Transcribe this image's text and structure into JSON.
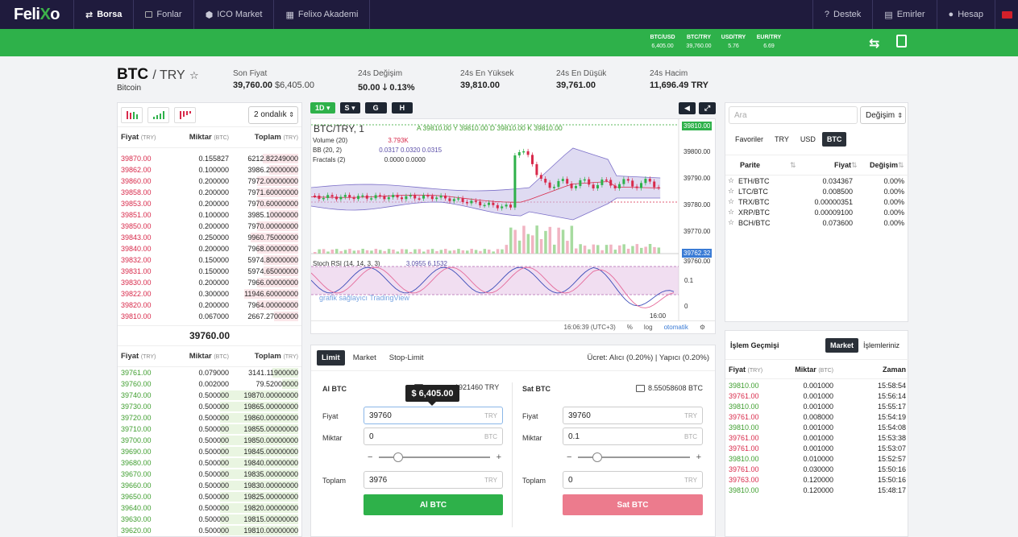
{
  "nav": {
    "logo_a": "Feli",
    "logo_x": "X",
    "logo_b": "o",
    "items": [
      {
        "label": "Borsa",
        "active": true
      },
      {
        "label": "Fonlar"
      },
      {
        "label": "ICO Market"
      },
      {
        "label": "Felixo Akademi"
      }
    ],
    "right": [
      {
        "label": "Destek"
      },
      {
        "label": "Emirler"
      },
      {
        "label": "Hesap"
      }
    ]
  },
  "tickers": [
    {
      "pair": "BTC/USD",
      "value": "6,405.00"
    },
    {
      "pair": "BTC/TRY",
      "value": "39,760.00"
    },
    {
      "pair": "USD/TRY",
      "value": "5.76"
    },
    {
      "pair": "EUR/TRY",
      "value": "6.69"
    }
  ],
  "header": {
    "symbol": "BTC",
    "quote": "/ TRY",
    "star": "☆",
    "name": "Bitcoin",
    "last": {
      "label": "Son Fiyat",
      "value": "39,760.00",
      "usd": "$6,405.00"
    },
    "change": {
      "label": "24s Değişim",
      "value": "50.00",
      "pct": "0.13%",
      "arrow": "🡓"
    },
    "high": {
      "label": "24s En Yüksek",
      "value": "39,810.00"
    },
    "low": {
      "label": "24s En Düşük",
      "value": "39,761.00"
    },
    "volume": {
      "label": "24s Hacim",
      "value": "11,696.49 TRY"
    }
  },
  "orderbook": {
    "decimals": "2 ondalık",
    "headers": {
      "price": "Fiyat",
      "price_unit": "(TRY)",
      "amount": "Miktar",
      "amount_unit": "(BTC)",
      "total": "Toplam",
      "total_unit": "(TRY)"
    },
    "asks": [
      [
        "39870.00",
        "0.155827",
        "6212.82249000"
      ],
      [
        "39862.00",
        "0.100000",
        "3986.20000000"
      ],
      [
        "39860.00",
        "0.200000",
        "7972.00000000"
      ],
      [
        "39858.00",
        "0.200000",
        "7971.60000000"
      ],
      [
        "39853.00",
        "0.200000",
        "7970.60000000"
      ],
      [
        "39851.00",
        "0.100000",
        "3985.10000000"
      ],
      [
        "39850.00",
        "0.200000",
        "7970.00000000"
      ],
      [
        "39843.00",
        "0.250000",
        "9960.75000000"
      ],
      [
        "39840.00",
        "0.200000",
        "7968.00000000"
      ],
      [
        "39832.00",
        "0.150000",
        "5974.80000000"
      ],
      [
        "39831.00",
        "0.150000",
        "5974.65000000"
      ],
      [
        "39830.00",
        "0.200000",
        "7966.00000000"
      ],
      [
        "39822.00",
        "0.300000",
        "11946.60000000"
      ],
      [
        "39820.00",
        "0.200000",
        "7964.00000000"
      ],
      [
        "39810.00",
        "0.067000",
        "2667.27000000"
      ]
    ],
    "mid": "39760.00",
    "bids": [
      [
        "39761.00",
        "0.079000",
        "3141.11900000"
      ],
      [
        "39760.00",
        "0.002000",
        "79.52000000"
      ],
      [
        "39740.00",
        "0.500000",
        "19870.00000000"
      ],
      [
        "39730.00",
        "0.500000",
        "19865.00000000"
      ],
      [
        "39720.00",
        "0.500000",
        "19860.00000000"
      ],
      [
        "39710.00",
        "0.500000",
        "19855.00000000"
      ],
      [
        "39700.00",
        "0.500000",
        "19850.00000000"
      ],
      [
        "39690.00",
        "0.500000",
        "19845.00000000"
      ],
      [
        "39680.00",
        "0.500000",
        "19840.00000000"
      ],
      [
        "39670.00",
        "0.500000",
        "19835.00000000"
      ],
      [
        "39660.00",
        "0.500000",
        "19830.00000000"
      ],
      [
        "39650.00",
        "0.500000",
        "19825.00000000"
      ],
      [
        "39640.00",
        "0.500000",
        "19820.00000000"
      ],
      [
        "39630.00",
        "0.500000",
        "19815.00000000"
      ],
      [
        "39620.00",
        "0.500000",
        "19810.00000000"
      ]
    ]
  },
  "chart": {
    "intervals": [
      "1D",
      "S",
      "G",
      "H"
    ],
    "title": "BTC/TRY, 1",
    "ohlc": "A 39810.00  Y 39810.00  D 39810.00  K 39810.00",
    "vol_label": "Volume (20)",
    "vol_val": "3.793K",
    "bb_label": "BB (20, 2)",
    "bb_vals": "0.0317  0.0320  0.0315",
    "fr_label": "Fractals (2)",
    "fr_vals": "0.0000  0.0000",
    "stoch_label": "Stoch RSI (14, 14, 3, 3)",
    "stoch_vals": "3.0955  6.1532",
    "watermark": "grafik sağlayıcı TradingView",
    "yticks": [
      "39810.00",
      "39800.00",
      "39790.00",
      "39780.00",
      "39770.00",
      "39762.32",
      "39760.00"
    ],
    "stoch_ticks": [
      "0.1",
      "0",
      "0.1"
    ],
    "time_tick": "16:00",
    "footer_time": "16:06:39 (UTC+3)",
    "footer_pct": "%",
    "footer_log": "log",
    "footer_auto": "otomatik"
  },
  "form": {
    "tabs": [
      "Limit",
      "Market",
      "Stop-Limit"
    ],
    "fee": "Ücret: Alıcı (0.20%) | Yapıcı (0.20%)",
    "buy": {
      "title": "Al BTC",
      "balance": "1921460 TRY",
      "price_label": "Fiyat",
      "price": "39760",
      "amount_label": "Miktar",
      "amount": "0",
      "total_label": "Toplam",
      "total": "3976",
      "button": "Al BTC"
    },
    "sell": {
      "title": "Sat BTC",
      "balance": "8.55058608 BTC",
      "price_label": "Fiyat",
      "price": "39760",
      "amount_label": "Miktar",
      "amount": "0.1",
      "total_label": "Toplam",
      "total": "0",
      "button": "Sat BTC"
    },
    "tooltip": "$ 6,405.00",
    "unit_try": "TRY",
    "unit_btc": "BTC"
  },
  "markets": {
    "search_placeholder": "Ara",
    "sort": "Değişim",
    "tabs": [
      "Favoriler",
      "TRY",
      "USD",
      "BTC"
    ],
    "headers": {
      "pair": "Parite",
      "price": "Fiyat",
      "change": "Değişim"
    },
    "rows": [
      [
        "ETH/BTC",
        "0.034367",
        "0.00%"
      ],
      [
        "LTC/BTC",
        "0.008500",
        "0.00%"
      ],
      [
        "TRX/BTC",
        "0.00000351",
        "0.00%"
      ],
      [
        "XRP/BTC",
        "0.00009100",
        "0.00%"
      ],
      [
        "BCH/BTC",
        "0.073600",
        "0.00%"
      ]
    ]
  },
  "history": {
    "title": "İşlem Geçmişi",
    "tabs": [
      "Market",
      "İşlemleriniz"
    ],
    "headers": {
      "price": "Fiyat",
      "price_unit": "(TRY)",
      "amount": "Miktar",
      "amount_unit": "(BTC)",
      "time": "Zaman"
    },
    "rows": [
      [
        "39810.00",
        "0.001000",
        "15:58:54",
        "g"
      ],
      [
        "39761.00",
        "0.001000",
        "15:56:14",
        "r"
      ],
      [
        "39810.00",
        "0.001000",
        "15:55:17",
        "g"
      ],
      [
        "39761.00",
        "0.008000",
        "15:54:19",
        "r"
      ],
      [
        "39810.00",
        "0.001000",
        "15:54:08",
        "g"
      ],
      [
        "39761.00",
        "0.001000",
        "15:53:38",
        "r"
      ],
      [
        "39761.00",
        "0.001000",
        "15:53:07",
        "r"
      ],
      [
        "39810.00",
        "0.010000",
        "15:52:57",
        "g"
      ],
      [
        "39761.00",
        "0.030000",
        "15:50:16",
        "r"
      ],
      [
        "39763.00",
        "0.120000",
        "15:50:16",
        "r"
      ],
      [
        "39810.00",
        "0.120000",
        "15:48:17",
        "g"
      ]
    ]
  },
  "colors": {
    "green": "#2eb14a",
    "nav": "#1f1b3d",
    "red": "#d8294a",
    "buy": "#2eb14a",
    "sell": "#ec7b8d"
  }
}
